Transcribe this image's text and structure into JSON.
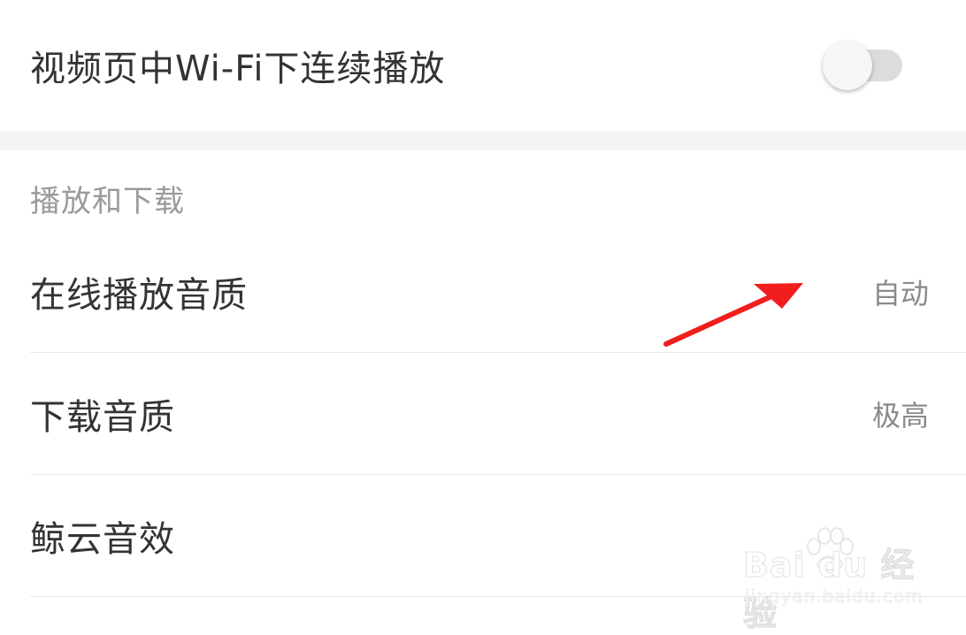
{
  "settings": {
    "wifi_autoplay": {
      "label": "视频页中Wi-Fi下连续播放",
      "enabled": false
    },
    "section": {
      "title": "播放和下载",
      "items": [
        {
          "label": "在线播放音质",
          "value": "自动"
        },
        {
          "label": "下载音质",
          "value": "极高"
        },
        {
          "label": "鲸云音效",
          "value": ""
        }
      ]
    }
  },
  "annotation": {
    "arrow_color": "#f21d1d"
  },
  "watermark": {
    "brand": "Bai du 经验",
    "url": "jingyan.baidu.com"
  },
  "colors": {
    "text_primary": "#333333",
    "text_secondary": "#8a8a8a",
    "section_header": "#9a9a9a",
    "toggle_track_off": "#dcdcdc"
  }
}
